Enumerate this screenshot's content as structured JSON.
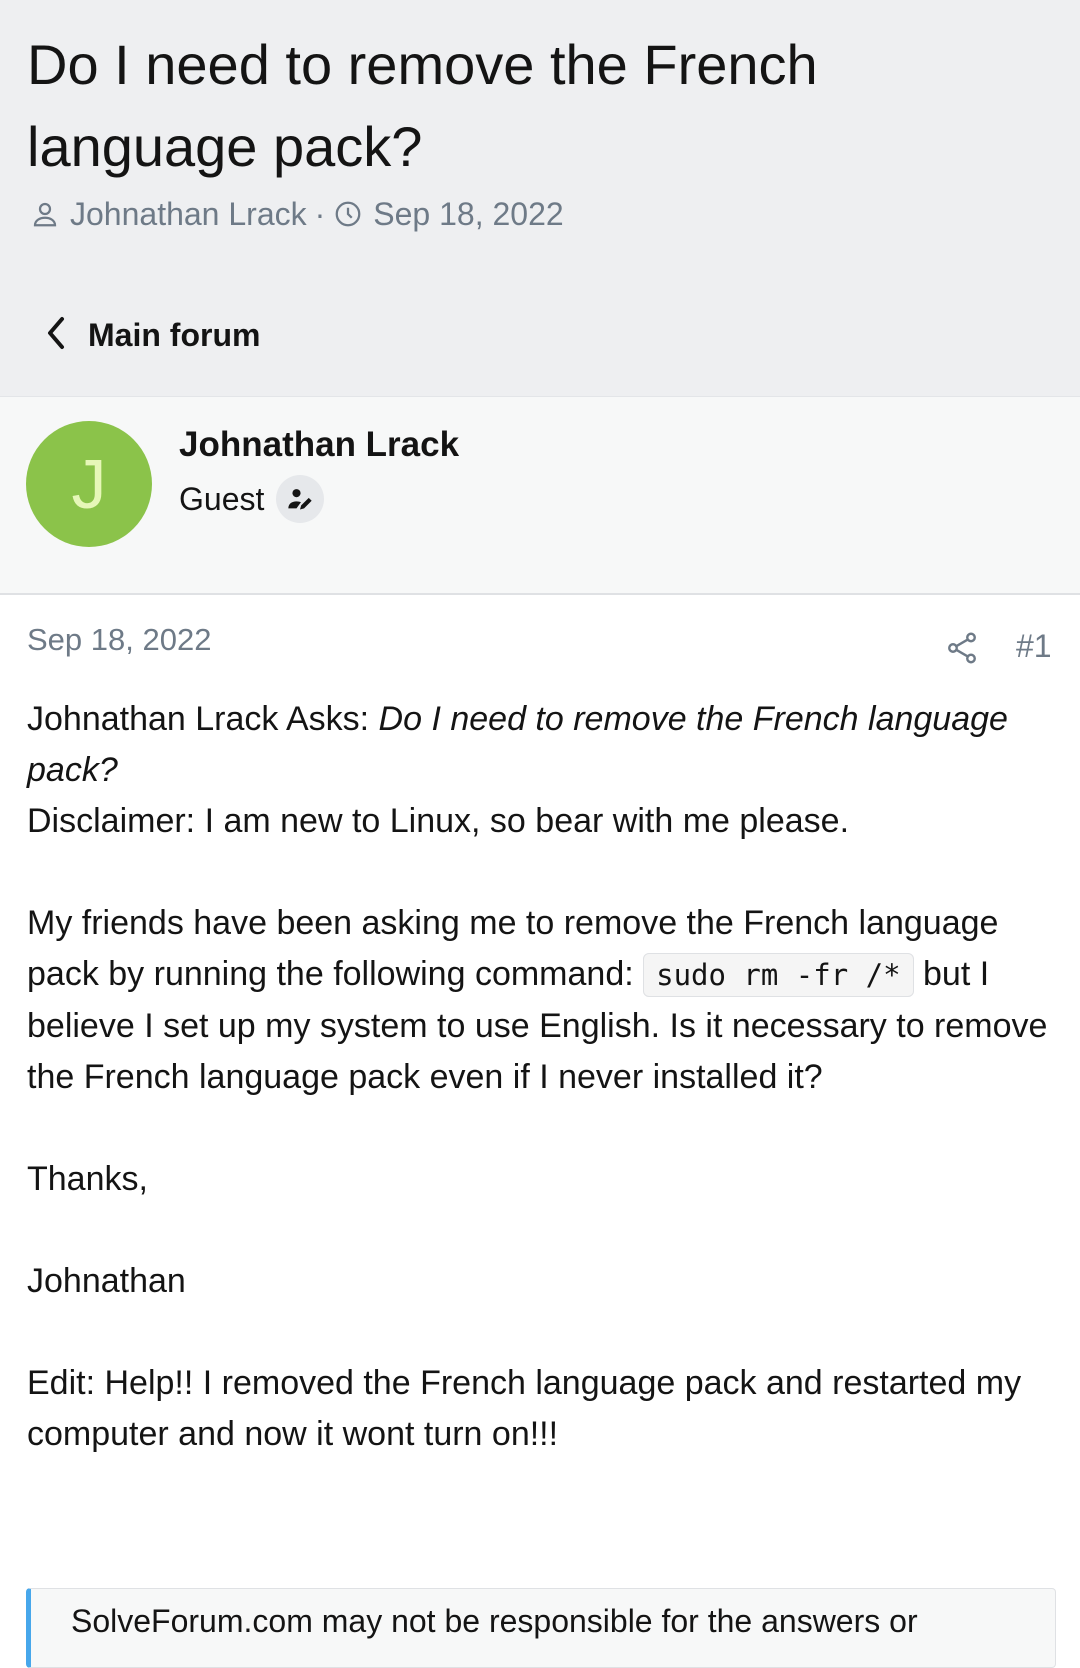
{
  "thread": {
    "title": "Do I need to remove the French language pack?",
    "author": "Johnathan Lrack",
    "meta_separator": "·",
    "date": "Sep 18, 2022"
  },
  "nav": {
    "back_label": "Main forum"
  },
  "post": {
    "avatar_letter": "J",
    "username": "Johnathan Lrack",
    "user_title": "Guest",
    "date": "Sep 18, 2022",
    "post_number": "#1",
    "asks_prefix": "Johnathan Lrack Asks: ",
    "asks_question": "Do I need to remove the French language pack?",
    "disclaimer": "Disclaimer: I am new to Linux, so bear with me please.",
    "para1_before": "My friends have been asking me to remove the French language pack by running the following command: ",
    "para1_code": "sudo rm -fr /*",
    "para1_after": " but I believe I set up my system to use English. Is it necessary to remove the French language pack even if I never installed it?",
    "thanks": "Thanks,",
    "signature": "Johnathan",
    "edit": "Edit: Help!! I removed the French language pack and restarted my computer and now it wont turn on!!!"
  },
  "notice": {
    "text": "SolveForum.com may not be responsible for the answers or"
  },
  "icons": {
    "author": "user-icon",
    "date": "clock-icon",
    "back": "chevron-left-icon",
    "badge": "user-edit-icon",
    "share": "share-icon"
  },
  "colors": {
    "header_bg": "#eeeff1",
    "avatar_bg": "#8bc34a",
    "avatar_letter": "#e6f7b8",
    "muted_text": "#6e7a87",
    "notice_accent": "#47a7eb"
  }
}
